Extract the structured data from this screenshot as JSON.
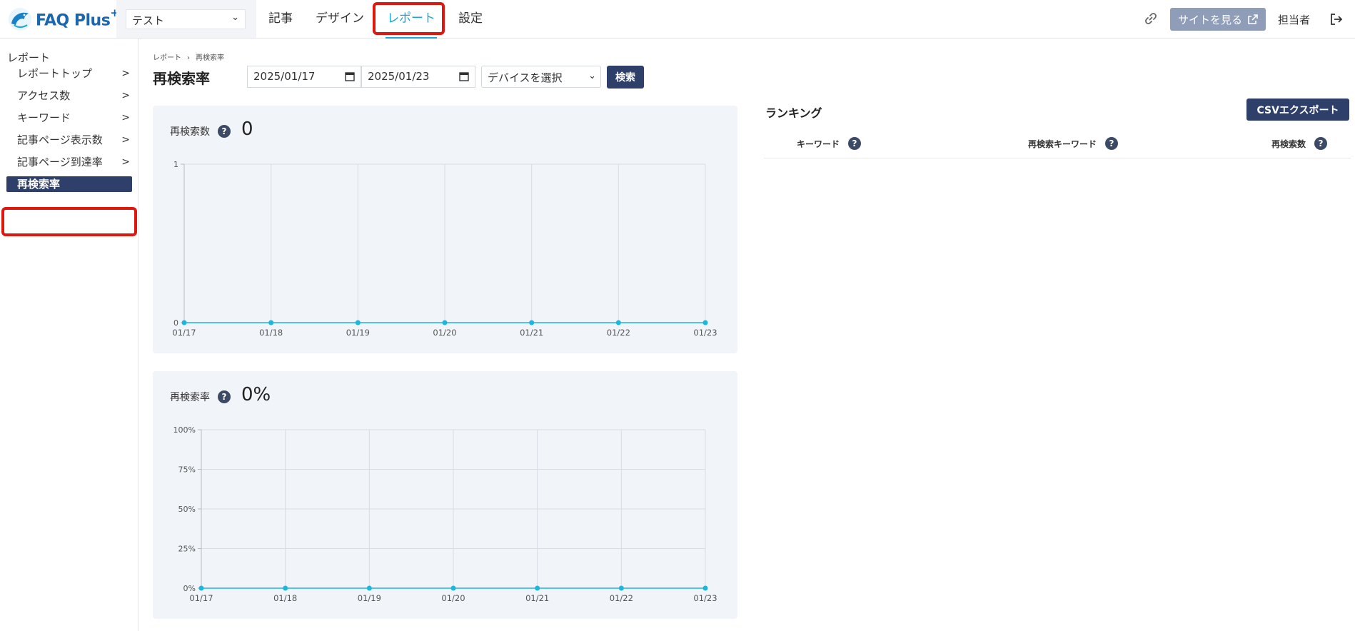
{
  "header": {
    "logo_text": "FAQ Plus",
    "logo_sup": "+",
    "site_select_value": "テスト",
    "nav": [
      {
        "label": "記事"
      },
      {
        "label": "デザイン"
      },
      {
        "label": "レポート"
      },
      {
        "label": "設定"
      }
    ],
    "view_site_label": "サイトを見る",
    "user_label": "担当者"
  },
  "sidebar": {
    "heading": "レポート",
    "items": [
      {
        "label": "レポートトップ",
        "arrow": ">"
      },
      {
        "label": "アクセス数",
        "arrow": ">"
      },
      {
        "label": "キーワード",
        "arrow": ">"
      },
      {
        "label": "記事ページ表示数",
        "arrow": ">"
      },
      {
        "label": "記事ページ到達率",
        "arrow": ">"
      },
      {
        "label": "再検索率"
      }
    ]
  },
  "main": {
    "breadcrumb": [
      "レポート",
      "›",
      "再検索率"
    ],
    "title": "再検索率",
    "date_from": "2025/01/17",
    "date_to": "2025/01/23",
    "device_select_value": "デバイスを選択",
    "search_label": "検索"
  },
  "cards": [
    {
      "title": "再検索数",
      "help": "?",
      "value": "0"
    },
    {
      "title": "再検索率",
      "help": "?",
      "value": "0%"
    }
  ],
  "ranking": {
    "title": "ランキング",
    "csv_label": "CSVエクスポート",
    "columns": [
      {
        "label": "キーワード",
        "help": "?"
      },
      {
        "label": "再検索キーワード",
        "help": "?"
      },
      {
        "label": "再検索数",
        "help": "?"
      }
    ]
  },
  "colors": {
    "accent": "#1aa7d8",
    "navy": "#2e3f6a",
    "line": "#1bb7e0",
    "highlight": "#e0170f"
  },
  "chart_data": [
    {
      "type": "line",
      "x": [
        "01/17",
        "01/18",
        "01/19",
        "01/20",
        "01/21",
        "01/22",
        "01/23"
      ],
      "series": [
        {
          "values": [
            0,
            0,
            0,
            0,
            0,
            0,
            0
          ]
        }
      ],
      "ylim": [
        0,
        1
      ],
      "yticks": [
        "0",
        "1"
      ],
      "grid": true
    },
    {
      "type": "line",
      "x": [
        "01/17",
        "01/18",
        "01/19",
        "01/20",
        "01/21",
        "01/22",
        "01/23"
      ],
      "series": [
        {
          "values": [
            0,
            0,
            0,
            0,
            0,
            0,
            0
          ]
        }
      ],
      "ylim": [
        0,
        100
      ],
      "yticks": [
        "0%",
        "25%",
        "50%",
        "75%",
        "100%"
      ],
      "grid": true
    }
  ]
}
